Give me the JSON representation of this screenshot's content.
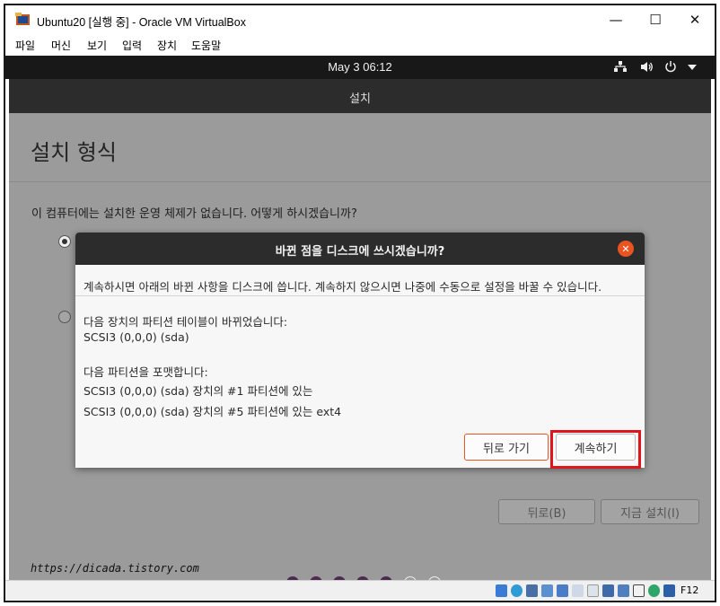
{
  "window": {
    "title": "Ubuntu20 [실행 중] - Oracle VM VirtualBox",
    "minimize": "—",
    "maximize": "☐",
    "close": "✕"
  },
  "menu": [
    "파일",
    "머신",
    "보기",
    "입력",
    "장치",
    "도움말"
  ],
  "topbar": {
    "clock": "May 3  06:12",
    "icons": [
      "network-icon",
      "volume-icon",
      "power-icon",
      "dropdown-icon"
    ]
  },
  "installer": {
    "header": "설치",
    "page_title": "설치 형식",
    "question": "이 컴퓨터에는 설치한 운영 체제가 없습니다. 어떻게 하시겠습니까?",
    "back_button": "뒤로(B)",
    "install_now_button": "지금 설치(I)",
    "progress": {
      "total": 7,
      "completed": 5
    }
  },
  "watermark": "https://dicada.tistory.com",
  "dialog": {
    "title": "바뀐 점을 디스크에 쓰시겠습니까?",
    "intro": "계속하시면 아래의 바뀐 사항을 디스크에 씁니다. 계속하지 않으시면 나중에 수동으로 설정을 바꿀 수 있습니다.",
    "partition_table_heading": "다음 장치의 파티션 테이블이 바뀌었습니다:",
    "partition_table_device": "SCSI3 (0,0,0) (sda)",
    "format_heading": "다음 파티션을 포맷합니다:",
    "format_items": [
      "SCSI3 (0,0,0) (sda) 장치의 #1 파티션에 있는",
      "SCSI3 (0,0,0) (sda) 장치의 #5 파티션에 있는 ext4"
    ],
    "back_button": "뒤로 가기",
    "continue_button": "계속하기"
  },
  "statusbar": {
    "host_key": "F12"
  },
  "colors": {
    "ubuntu_orange": "#e95420",
    "highlight_red": "#e0141c",
    "progress_dot": "#4e2a52"
  }
}
